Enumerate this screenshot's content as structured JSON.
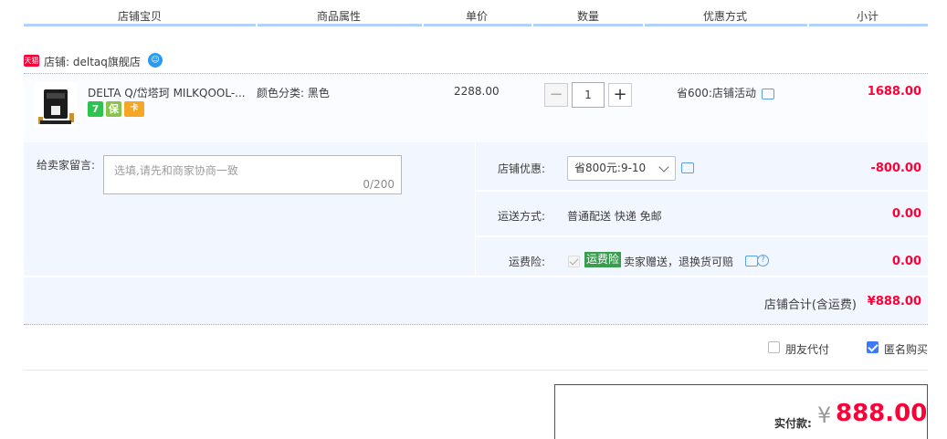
{
  "header": {
    "col_item": "店铺宝贝",
    "col_attr": "商品属性",
    "col_price": "单价",
    "col_qty": "数量",
    "col_promo": "优惠方式",
    "col_subtotal": "小计"
  },
  "shop": {
    "tag": "天猫",
    "name": "店铺: deltaq旗舰店"
  },
  "item": {
    "title": "DELTA Q/岱塔珂 MILKQOOL-...",
    "attr": "颜色分类: 黑色",
    "price": "2288.00",
    "quantity": "1",
    "promo": "省600:店铺活动",
    "subtotal": "1688.00",
    "badges": [
      "7",
      "保",
      "卡"
    ]
  },
  "memo": {
    "label": "给卖家留言:",
    "placeholder": "选填,请先和商家协商一致",
    "count": "0/200"
  },
  "shop_discount": {
    "label": "店铺优惠:",
    "selected": "省800元:9-10",
    "value": "-800.00"
  },
  "shipping": {
    "label": "运送方式:",
    "method": "普通配送 快递 免邮",
    "value": "0.00"
  },
  "insurance": {
    "label": "运费险:",
    "tag": "运费险",
    "desc": "卖家赠送，退换货可赔",
    "value": "0.00"
  },
  "shop_total": {
    "label": "店铺合计(含运费)",
    "value": "¥888.00"
  },
  "options": {
    "friend_pay": "朋友代付",
    "friend_pay_checked": false,
    "anonymous": "匿名购买",
    "anonymous_checked": true
  },
  "payment": {
    "label": "实付款:",
    "currency": "¥",
    "amount": "888.00"
  },
  "colors": {
    "accent_red": "#ff0036",
    "header_line": "#b2d1ff",
    "panel_bg": "#f2f7ff"
  }
}
